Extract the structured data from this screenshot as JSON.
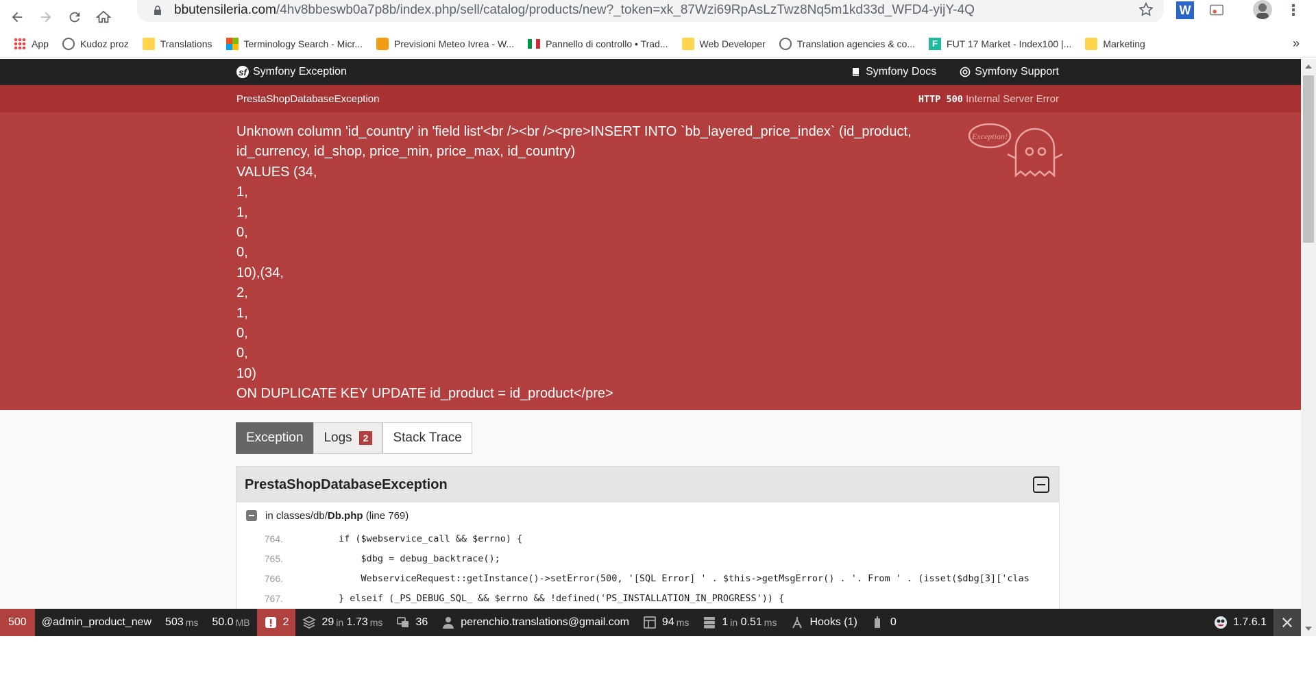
{
  "browser": {
    "url_host": "bbutensileria.com",
    "url_path": "/4hv8bbeswb0a7p8b/index.php/sell/catalog/products/new?_token=xk_87Wzi69RpAsLzTwz8Nq5m1kd33d_WFD4-yijY-4Q",
    "bookmarks": [
      {
        "label": "App",
        "icon": "apps-grid-icon"
      },
      {
        "label": "Kudoz proz",
        "icon": "proz-icon"
      },
      {
        "label": "Translations",
        "icon": "folder-icon"
      },
      {
        "label": "Terminology Search - Micr...",
        "icon": "microsoft-icon"
      },
      {
        "label": "Previsioni Meteo Ivrea - W...",
        "icon": "meteo-icon"
      },
      {
        "label": "Pannello di controllo • Trad...",
        "icon": "italy-flag-icon"
      },
      {
        "label": "Web Developer",
        "icon": "folder-icon"
      },
      {
        "label": "Translation agencies & co...",
        "icon": "proz-icon"
      },
      {
        "label": "FUT 17 Market - Index100 |...",
        "icon": "fut-icon"
      },
      {
        "label": "Marketing",
        "icon": "folder-icon"
      }
    ],
    "more": "»"
  },
  "symfony": {
    "title": "Symfony Exception",
    "docs": "Symfony Docs",
    "support": "Symfony Support",
    "exception_class": "PrestaShopDatabaseException",
    "http_code": "HTTP 500",
    "http_text": "Internal Server Error",
    "message": "Unknown column 'id_country' in 'field list'<br /><br /><pre>INSERT INTO `bb_layered_price_index` (id_product, id_currency, id_shop, price_min, price_max, id_country)\nVALUES (34,\n1,\n1,\n0,\n0,\n10),(34,\n2,\n1,\n0,\n0,\n10)\nON DUPLICATE KEY UPDATE id_product = id_product</pre>",
    "ghost_label": "Exception!"
  },
  "tabs": {
    "exception": "Exception",
    "logs": "Logs",
    "logs_count": "2",
    "stack": "Stack Trace"
  },
  "trace": {
    "title": "PrestaShopDatabaseException",
    "file_prefix": "in classes/db/",
    "file_name": "Db.php",
    "file_line": "(line 769)",
    "lines": [
      {
        "n": "764.",
        "code": "        if ($webservice_call && $errno) {"
      },
      {
        "n": "765.",
        "code": "            $dbg = debug_backtrace();"
      },
      {
        "n": "766.",
        "code": "            WebserviceRequest::getInstance()->setError(500, '[SQL Error] ' . $this->getMsgError() . '. From ' . (isset($dbg[3]['clas"
      },
      {
        "n": "767.",
        "code": "        } elseif (_PS_DEBUG_SQL_ && $errno && !defined('PS_INSTALLATION_IN_PROGRESS')) {"
      }
    ]
  },
  "toolbar": {
    "status": "500",
    "route": "@admin_product_new",
    "time_value": "503",
    "time_unit": "ms",
    "memory_value": "50.0",
    "memory_unit": "MB",
    "errors": "2",
    "db_queries": "29",
    "db_in": "in",
    "db_time": "1.73",
    "db_unit": "ms",
    "translations": "36",
    "user": "perenchio.translations@gmail.com",
    "render_time": "94",
    "render_unit": "ms",
    "cache_count": "1",
    "cache_in": "in",
    "cache_time": "0.51",
    "cache_unit": "ms",
    "hooks": "Hooks (1)",
    "modules": "0",
    "version": "1.7.6.1"
  },
  "colors": {
    "error_red": "#b23e3e",
    "dark": "#222222"
  }
}
